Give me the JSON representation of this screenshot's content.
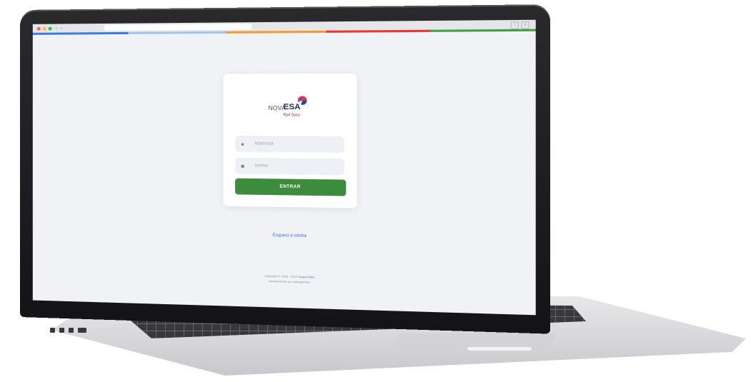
{
  "browser": {
    "dot_colors": [
      "#ff5f57",
      "#febc2e",
      "#28c840"
    ],
    "back_icon": "chevron-left-icon",
    "forward_icon": "chevron-right-icon"
  },
  "brand_strip": {
    "colors": [
      "#3b7ddd",
      "#9ec7ea",
      "#f29b2f",
      "#e53935",
      "#43a047"
    ]
  },
  "logo": {
    "nova": "NOVA",
    "esa": "ESA",
    "subtitle": "Ry4 Sucu"
  },
  "login": {
    "username_placeholder": "Matrícula",
    "username_icon": "user-icon",
    "password_placeholder": "Senha",
    "password_icon": "lock-icon",
    "submit_label": "ENTRAR",
    "submit_color": "#3d8b3d"
  },
  "forgot_password": {
    "label": "Esqueci a senha"
  },
  "footer": {
    "copyright": "Copyright © 2005 - 2022",
    "brand": "Grupo Elfen",
    "developed_by": "Desenvolvido por Infoeglemen"
  }
}
